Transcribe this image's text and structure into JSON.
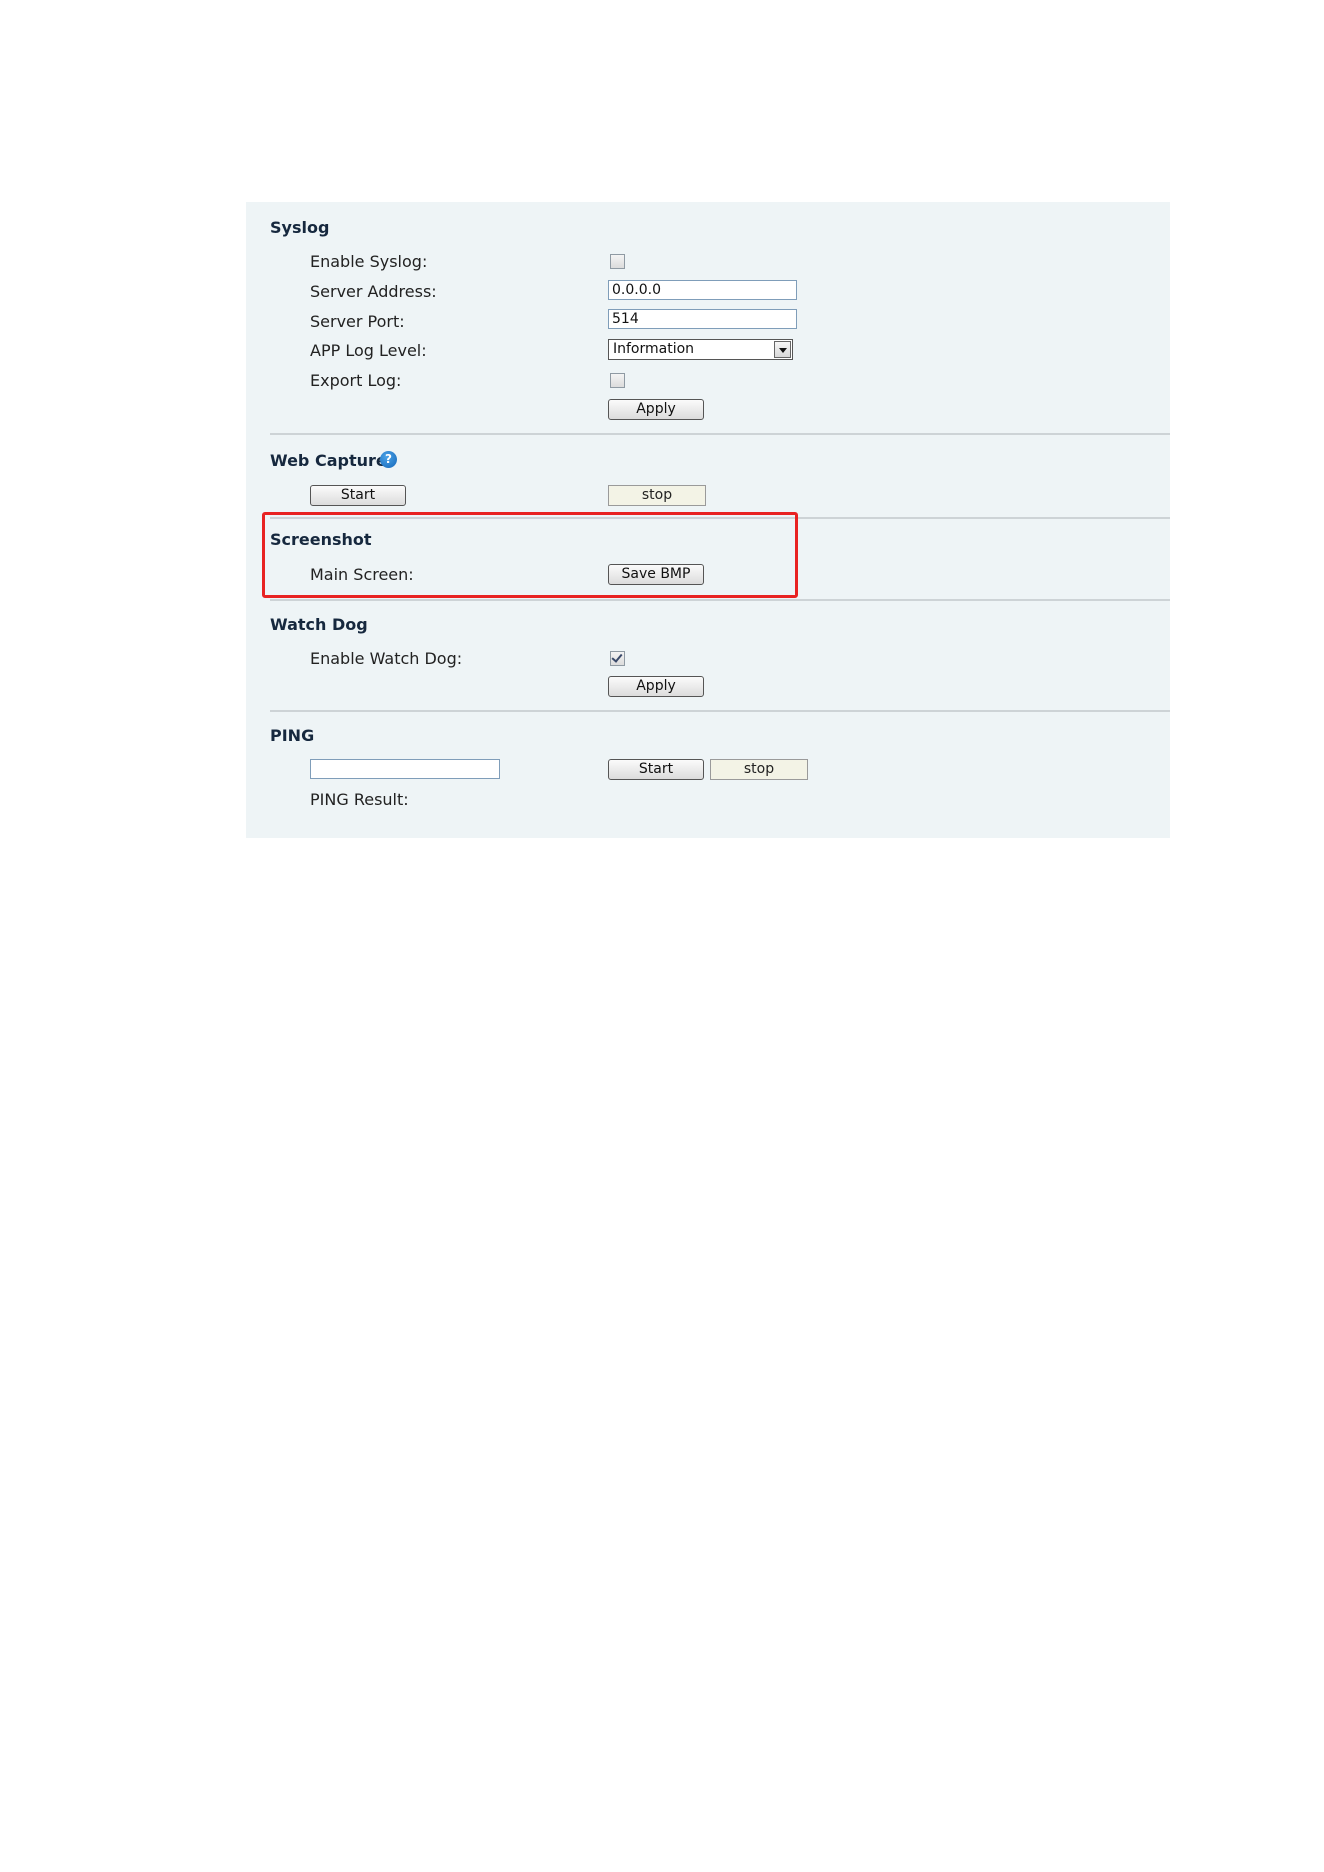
{
  "syslog": {
    "title": "Syslog",
    "enable_label": "Enable Syslog:",
    "enable_checked": false,
    "server_address_label": "Server Address:",
    "server_address_value": "0.0.0.0",
    "server_port_label": "Server Port:",
    "server_port_value": "514",
    "app_log_level_label": "APP Log Level:",
    "app_log_level_value": "Information",
    "export_log_label": "Export Log:",
    "export_log_checked": false,
    "apply_label": "Apply"
  },
  "web_capture": {
    "title": "Web Capture",
    "help_icon": "help-icon",
    "start_label": "Start",
    "stop_label": "stop"
  },
  "screenshot": {
    "title": "Screenshot",
    "main_screen_label": "Main Screen:",
    "save_bmp_label": "Save BMP",
    "highlight_color": "#e82222"
  },
  "watch_dog": {
    "title": "Watch Dog",
    "enable_label": "Enable Watch Dog:",
    "enable_checked": true,
    "apply_label": "Apply"
  },
  "ping": {
    "title": "PING",
    "address_value": "",
    "start_label": "Start",
    "stop_label": "stop",
    "result_label": "PING Result:"
  },
  "colors": {
    "panel_background": "#eef4f6",
    "section_title": "#16283e"
  }
}
